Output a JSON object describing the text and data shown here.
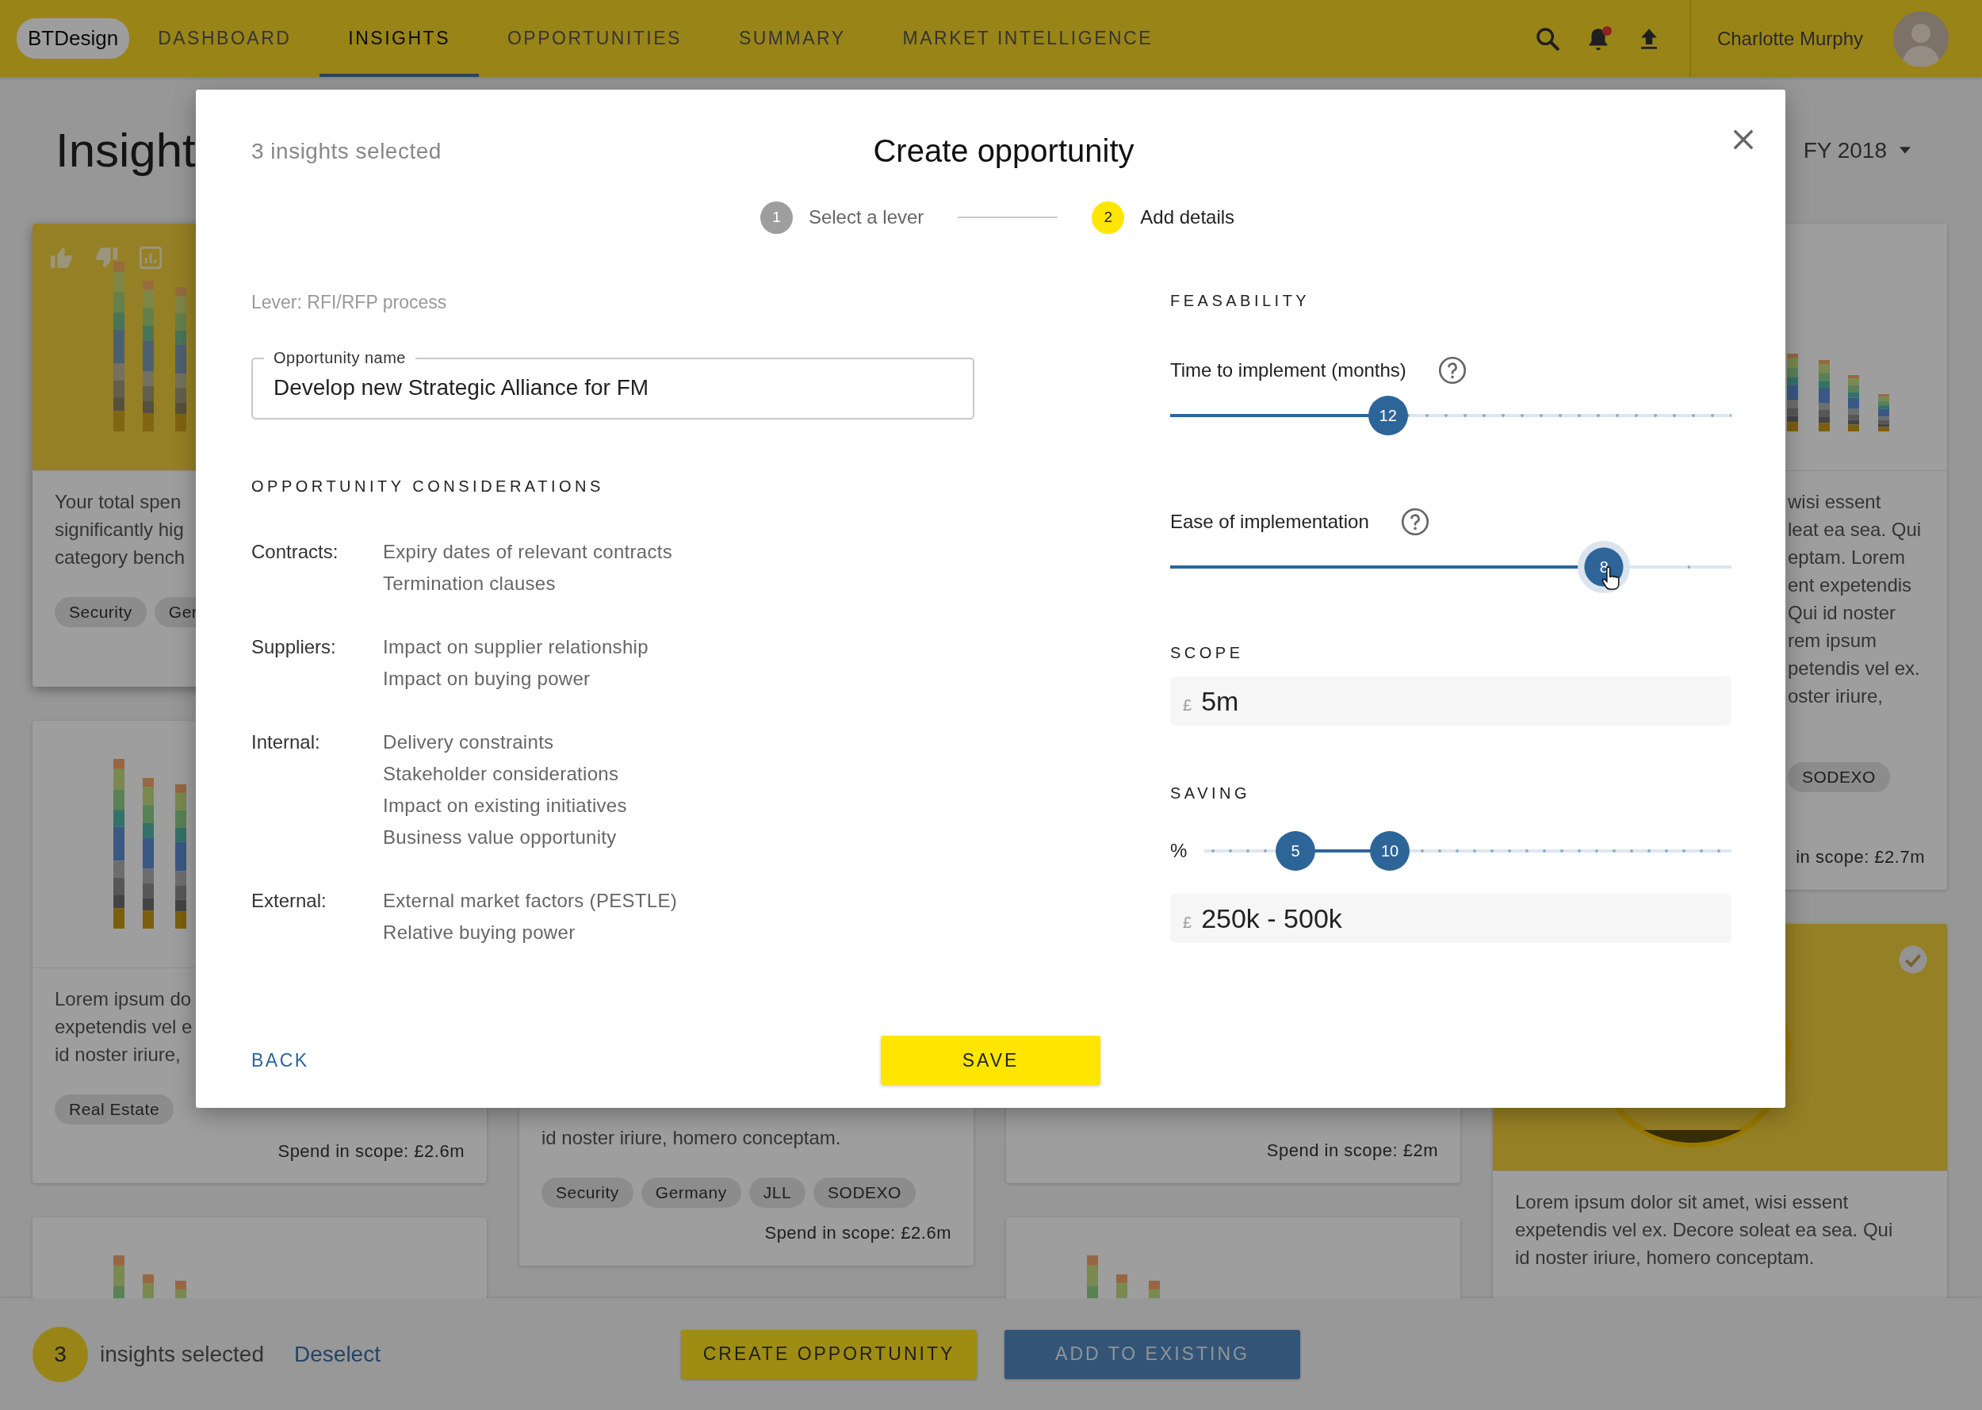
{
  "header": {
    "logo": "BTDesign",
    "nav": [
      {
        "label": "DASHBOARD",
        "selected": false
      },
      {
        "label": "INSIGHTS",
        "selected": true
      },
      {
        "label": "OPPORTUNITIES",
        "selected": false
      },
      {
        "label": "SUMMARY",
        "selected": false
      },
      {
        "label": "MARKET INTELLIGENCE",
        "selected": false
      }
    ],
    "notifications_unread": true,
    "user_name": "Charlotte Murphy"
  },
  "page": {
    "title": "Insight",
    "period": "FY 2018"
  },
  "columns": [
    {
      "cards": [
        {
          "selected": true,
          "hovered": true,
          "kind": "bars",
          "text": [
            "Your total spen",
            "significantly hig",
            "category bench"
          ],
          "tags": [
            "Security",
            "Ger"
          ]
        },
        {
          "selected": false,
          "hovered": false,
          "kind": "bars",
          "text": [
            "Lorem ipsum do",
            "expetendis vel e",
            "id noster iriure,"
          ],
          "tags": [
            "Real Estate"
          ],
          "spend": "Spend in scope: £2.6m"
        },
        {
          "selected": false,
          "hovered": false,
          "kind": "bars"
        }
      ]
    },
    {
      "cards": [
        {
          "selected": false,
          "hovered": false,
          "kind": "plain",
          "text": [
            "id noster iriure, homero conceptam."
          ],
          "tags": [
            "Security",
            "Germany",
            "JLL",
            "SODEXO"
          ],
          "spend": "Spend in scope: £2.6m"
        }
      ]
    },
    {
      "cards": [
        {
          "selected": false,
          "hovered": false,
          "kind": "plain",
          "spend": "Spend in scope: £2m"
        },
        {
          "selected": false,
          "hovered": false,
          "kind": "bars"
        }
      ]
    },
    {
      "cards": [
        {
          "selected": false,
          "hovered": false,
          "kind": "columns",
          "text": [
            "wisi essent",
            "leat ea sea. Qui",
            "eptam. Lorem",
            "ent expetendis",
            "Qui id noster",
            "rem ipsum",
            "petendis vel ex.",
            "oster iriure,"
          ],
          "tags": [
            "SODEXO"
          ],
          "spend": "in scope: £2.7m"
        },
        {
          "selected": true,
          "hovered": false,
          "kind": "ring",
          "text": [
            "Lorem ipsum dolor sit amet, wisi essent",
            "expetendis vel ex. Decore soleat ea sea. Qui",
            "id noster iriure, homero conceptam."
          ]
        }
      ]
    }
  ],
  "selection_bar": {
    "count": "3",
    "label": "insights selected",
    "link": "Deselect",
    "buttons": [
      {
        "label": "CREATE OPPORTUNITY",
        "kind": "primary"
      },
      {
        "label": "ADD TO EXISTING",
        "kind": "secondary"
      }
    ]
  },
  "modal": {
    "subtitle": "3 insights selected",
    "title": "Create opportunity",
    "steps": [
      {
        "number": "1",
        "label": "Select a lever",
        "selected": false
      },
      {
        "number": "2",
        "label": "Add details",
        "selected": true
      }
    ],
    "lever": "Lever: RFI/RFP process",
    "name_field": {
      "label": "Opportunity name",
      "value": "Develop new Strategic Alliance for FM"
    },
    "considerations": {
      "heading": "OPPORTUNITY CONSIDERATIONS",
      "groups": [
        {
          "label": "Contracts:",
          "items": [
            "Expiry dates of relevant contracts",
            "Termination clauses"
          ]
        },
        {
          "label": "Suppliers:",
          "items": [
            "Impact on supplier relationship",
            "Impact on buying power"
          ]
        },
        {
          "label": "Internal:",
          "items": [
            "Delivery constraints",
            "Stakeholder considerations",
            "Impact on existing initiatives",
            "Business value opportunity"
          ]
        },
        {
          "label": "External:",
          "items": [
            "External market factors (PESTLE)",
            "Relative buying power"
          ]
        }
      ]
    },
    "feasability": {
      "heading": "FEASABILITY",
      "sliders": [
        {
          "label": "Time to implement (months)",
          "value": "12",
          "level": 0.388,
          "focused": false
        },
        {
          "label": "Ease of implementation",
          "value": "8",
          "level": 0.773,
          "focused": true
        }
      ]
    },
    "scope": {
      "heading": "SCOPE",
      "currency": "£",
      "value": "5m"
    },
    "saving": {
      "heading": "SAVING",
      "unit": "%",
      "handles": [
        {
          "value": "5",
          "level": 0.173
        },
        {
          "value": "10",
          "level": 0.352
        }
      ],
      "currency": "£",
      "value": "250k - 500k"
    },
    "actions": {
      "back": "BACK",
      "save": "SAVE"
    }
  }
}
